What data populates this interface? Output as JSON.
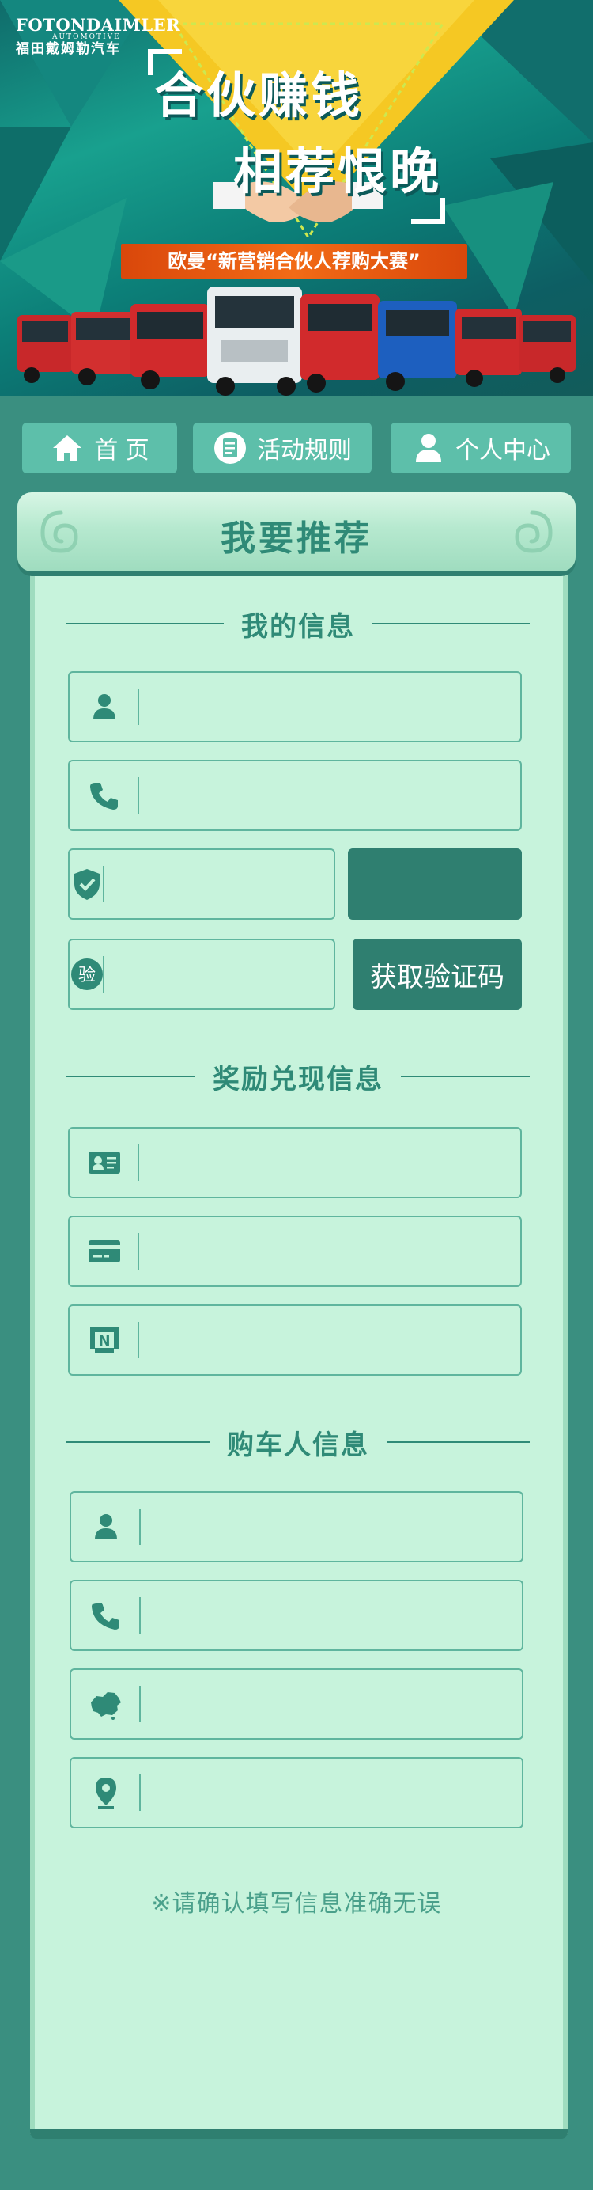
{
  "brand": {
    "logo_line1": "FOTONDAIMLER",
    "logo_line2": "AUTOMOTIVE",
    "logo_line3": "福田戴姆勒汽车"
  },
  "hero": {
    "headline_1": "合伙赚钱",
    "headline_2": "相荐恨晚",
    "subtitle": "欧曼“新营销合伙人荐购大赛”"
  },
  "nav": {
    "home": "首 页",
    "rules": "活动规则",
    "profile": "个人中心"
  },
  "scroll": {
    "title": "我要推荐"
  },
  "sections": {
    "my_info": "我的信息",
    "reward_info": "奖励兑现信息",
    "buyer_info": "购车人信息"
  },
  "my_info": {
    "name": "",
    "phone": "",
    "captcha": "",
    "sms_code": "",
    "sms_button": "获取验证码"
  },
  "reward_info": {
    "id_card": "",
    "bank_card": "",
    "bank_name": ""
  },
  "buyer_info": {
    "name": "",
    "phone": "",
    "region": "",
    "address": ""
  },
  "icons": {
    "home": "home-icon",
    "rules": "document-icon",
    "profile": "user-icon",
    "name": "user-icon",
    "phone": "phone-icon",
    "captcha": "shield-check-icon",
    "sms": "verify-icon",
    "id_card": "id-card-icon",
    "bank_card": "bank-card-icon",
    "bank_name": "bank-icon",
    "region": "china-map-icon",
    "address": "location-pin-icon"
  },
  "note": "※请确认填写信息准确无误",
  "colors": {
    "accent": "#2f8a77",
    "scroll_bg": "#c7f3dc",
    "nav_bg": "#5dbfaa",
    "subbanner": "#f26b16",
    "headline_yellow": "#f5c823"
  }
}
